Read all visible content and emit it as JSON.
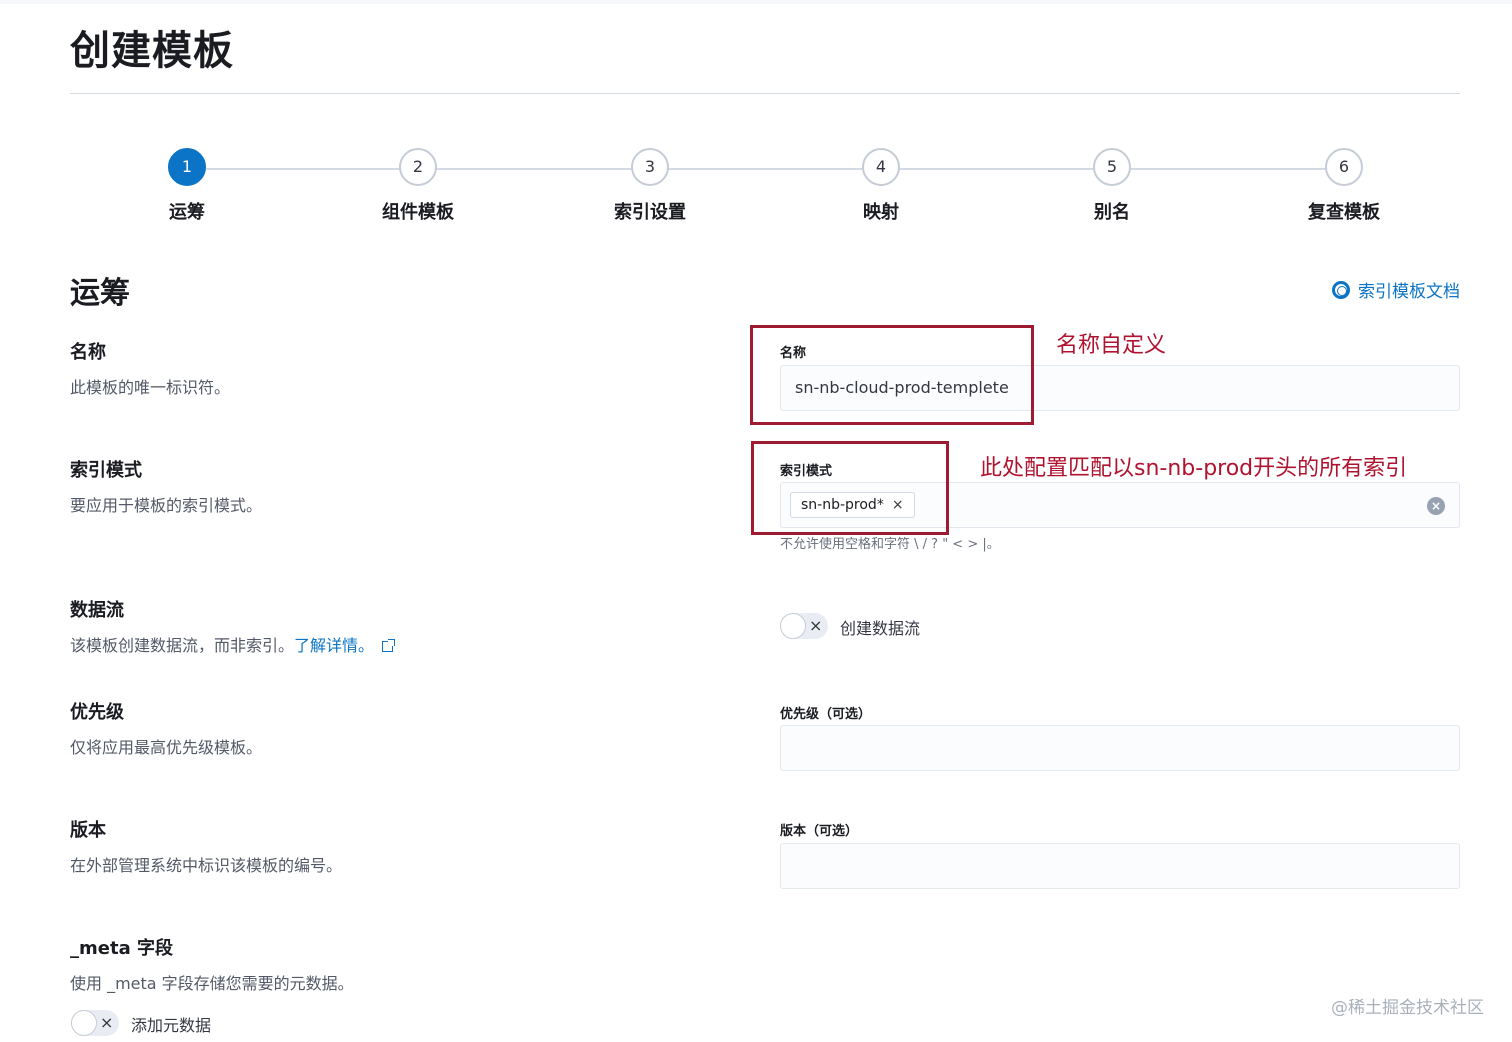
{
  "page": {
    "title": "创建模板"
  },
  "steps": [
    {
      "number": "1",
      "label": "运筹",
      "active": true
    },
    {
      "number": "2",
      "label": "组件模板",
      "active": false
    },
    {
      "number": "3",
      "label": "索引设置",
      "active": false
    },
    {
      "number": "4",
      "label": "映射",
      "active": false
    },
    {
      "number": "5",
      "label": "别名",
      "active": false
    },
    {
      "number": "6",
      "label": "复查模板",
      "active": false
    }
  ],
  "section": {
    "title": "运筹",
    "doc_link": "索引模板文档",
    "doc_icon": "lifebuoy-icon"
  },
  "name_row": {
    "title": "名称",
    "description": "此模板的唯一标识符。",
    "field_label": "名称",
    "value": "sn-nb-cloud-prod-templete"
  },
  "index_row": {
    "title": "索引模式",
    "description": "要应用于模板的索引模式。",
    "field_label": "索引模式",
    "chip": "sn-nb-prod*",
    "chip_remove": "×",
    "clear": "×",
    "help": "不允许使用空格和字符 \\ / ? \" < > |。"
  },
  "datastream_row": {
    "title": "数据流",
    "description": "该模板创建数据流，而非索引。",
    "learn_more": "了解详情。",
    "toggle_label": "创建数据流",
    "toggle_mark": "×"
  },
  "priority_row": {
    "title": "优先级",
    "description": "仅将应用最高优先级模板。",
    "field_label": "优先级（可选）",
    "value": ""
  },
  "version_row": {
    "title": "版本",
    "description": "在外部管理系统中标识该模板的编号。",
    "field_label": "版本（可选）",
    "value": ""
  },
  "meta_row": {
    "title": "_meta 字段",
    "description": "使用 _meta 字段存储您需要的元数据。",
    "toggle_label": "添加元数据",
    "toggle_mark": "×"
  },
  "annotations": {
    "name_note": "名称自定义",
    "index_note": "此处配置匹配以sn-nb-prod开头的所有索引"
  },
  "watermark": "@稀土掘金技术社区",
  "colors": {
    "accent": "#0b74c6",
    "annotation": "#9e1b32"
  }
}
